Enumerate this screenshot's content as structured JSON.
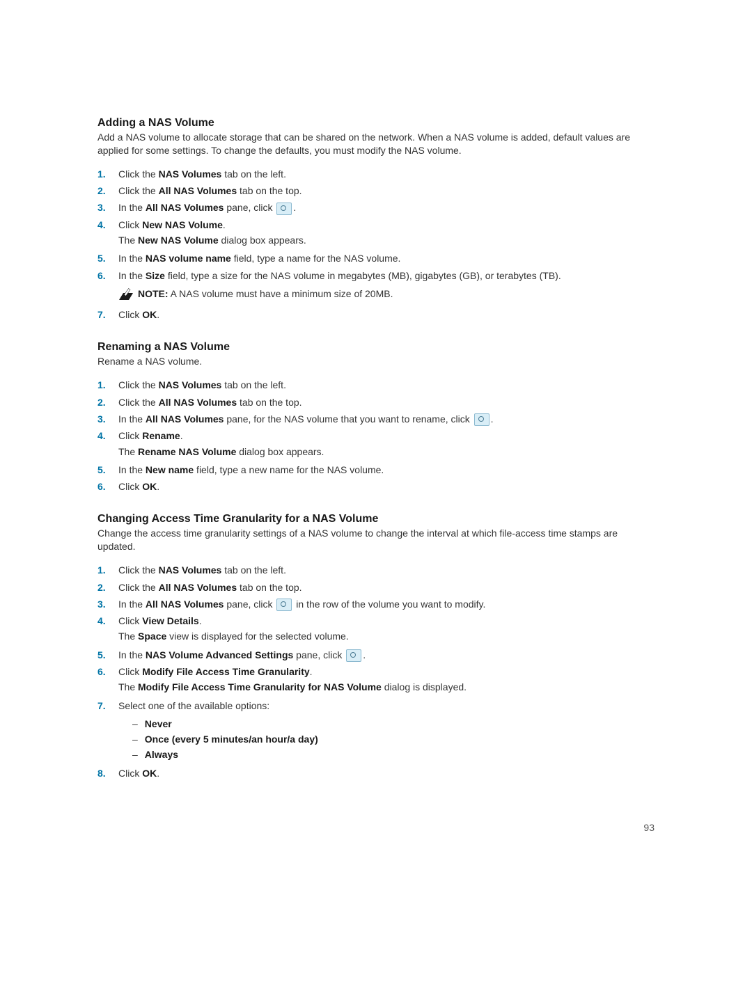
{
  "page_number": "93",
  "icons": {
    "gear": "settings-gear-icon",
    "note": "note-pencil-icon"
  },
  "sections": [
    {
      "heading": "Adding a NAS Volume",
      "intro": "Add a NAS volume to allocate storage that can be shared on the network. When a NAS volume is added, default values are applied for some settings. To change the defaults, you must modify the NAS volume.",
      "steps": [
        {
          "n": "1.",
          "parts": [
            "Click the ",
            "NAS Volumes",
            " tab on the left."
          ]
        },
        {
          "n": "2.",
          "parts": [
            "Click the ",
            "All NAS Volumes",
            " tab on the top."
          ]
        },
        {
          "n": "3.",
          "parts_pre": [
            "In the ",
            "All NAS Volumes",
            " pane, click "
          ],
          "icon": "gear",
          "parts_post": [
            "."
          ]
        },
        {
          "n": "4.",
          "parts": [
            "Click ",
            "New NAS Volume",
            "."
          ],
          "sub": [
            "The ",
            "New NAS Volume",
            " dialog box appears."
          ]
        },
        {
          "n": "5.",
          "parts": [
            "In the ",
            "NAS volume name",
            " field, type a name for the NAS volume."
          ]
        },
        {
          "n": "6.",
          "parts": [
            "In the ",
            "Size",
            " field, type a size for the NAS volume in megabytes (MB), gigabytes (GB), or terabytes (TB)."
          ],
          "note": {
            "label": "NOTE:",
            "text": " A NAS volume must have a minimum size of 20MB."
          }
        },
        {
          "n": "7.",
          "parts": [
            "Click ",
            "OK",
            "."
          ]
        }
      ]
    },
    {
      "heading": "Renaming a NAS Volume",
      "intro": "Rename a NAS volume.",
      "steps": [
        {
          "n": "1.",
          "parts": [
            "Click the ",
            "NAS Volumes",
            " tab on the left."
          ]
        },
        {
          "n": "2.",
          "parts": [
            "Click the ",
            "All NAS Volumes",
            " tab on the top."
          ]
        },
        {
          "n": "3.",
          "parts_pre": [
            "In the ",
            "All NAS Volumes",
            " pane, for the NAS volume that you want to rename, click "
          ],
          "icon": "gear",
          "parts_post": [
            "."
          ]
        },
        {
          "n": "4.",
          "parts": [
            "Click ",
            "Rename",
            "."
          ],
          "sub": [
            "The ",
            "Rename NAS Volume",
            " dialog box appears."
          ]
        },
        {
          "n": "5.",
          "parts": [
            "In the ",
            "New name",
            " field, type a new name for the NAS volume."
          ]
        },
        {
          "n": "6.",
          "parts": [
            "Click ",
            "OK",
            "."
          ]
        }
      ]
    },
    {
      "heading": "Changing Access Time Granularity for a NAS Volume",
      "intro": "Change the access time granularity settings of a NAS volume to change the interval at which file-access time stamps are updated.",
      "steps": [
        {
          "n": "1.",
          "parts": [
            "Click the ",
            "NAS Volumes",
            " tab on the left."
          ]
        },
        {
          "n": "2.",
          "parts": [
            "Click the ",
            "All NAS Volumes",
            " tab on the top."
          ]
        },
        {
          "n": "3.",
          "parts_pre": [
            "In the ",
            "All NAS Volumes",
            " pane, click "
          ],
          "icon": "gear",
          "parts_post": [
            " in the row of the volume you want to modify."
          ]
        },
        {
          "n": "4.",
          "parts": [
            "Click ",
            "View Details",
            "."
          ],
          "sub": [
            "The ",
            "Space",
            " view is displayed for the selected volume."
          ]
        },
        {
          "n": "5.",
          "parts_pre": [
            "In the ",
            "NAS Volume Advanced Settings",
            " pane, click "
          ],
          "icon": "gear",
          "parts_post": [
            "."
          ]
        },
        {
          "n": "6.",
          "parts": [
            "Click ",
            "Modify File Access Time Granularity",
            "."
          ],
          "sub": [
            "The ",
            "Modify File Access Time Granularity for NAS Volume",
            " dialog is displayed."
          ]
        },
        {
          "n": "7.",
          "parts": [
            "Select one of the available options:"
          ],
          "bullets": [
            "Never",
            "Once (every 5 minutes/an hour/a day)",
            "Always"
          ]
        },
        {
          "n": "8.",
          "parts": [
            "Click ",
            "OK",
            "."
          ]
        }
      ]
    }
  ]
}
